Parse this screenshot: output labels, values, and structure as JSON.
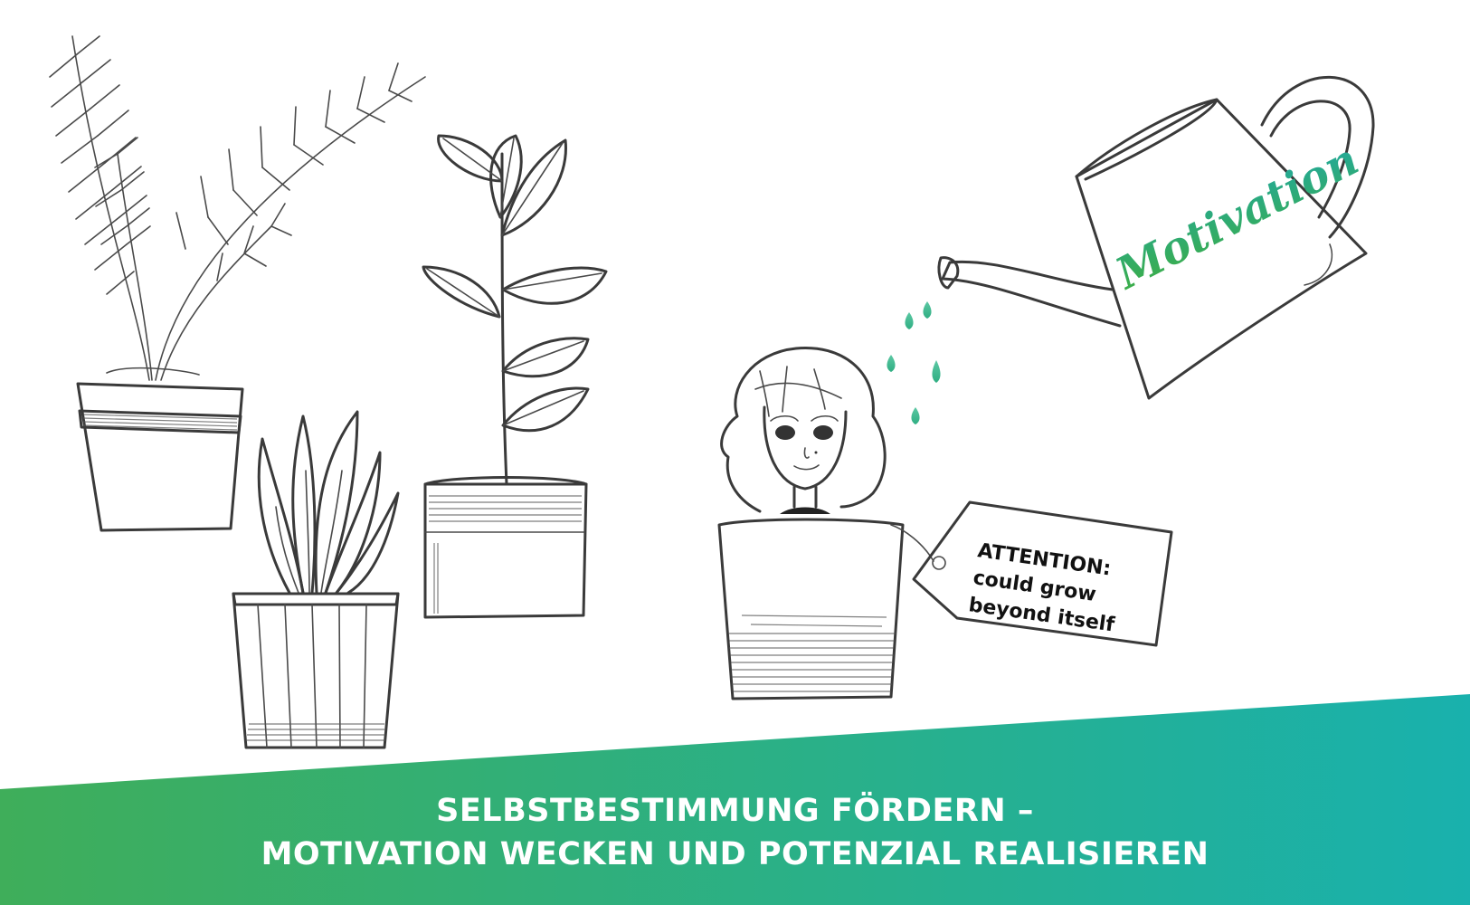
{
  "can": {
    "label": "Motivation"
  },
  "tag": {
    "line1": "ATTENTION:",
    "line2": "could grow",
    "line3": "beyond itself"
  },
  "banner": {
    "line1": "SELBSTBESTIMMUNG FÖRDERN –",
    "line2": "MOTIVATION WECKEN UND POTENZIAL REALISIEREN"
  },
  "colors": {
    "gradient_start": "#3fae5a",
    "gradient_end": "#19b1ad",
    "drop": "#4cbf9a",
    "ink": "#3a3a3a"
  }
}
